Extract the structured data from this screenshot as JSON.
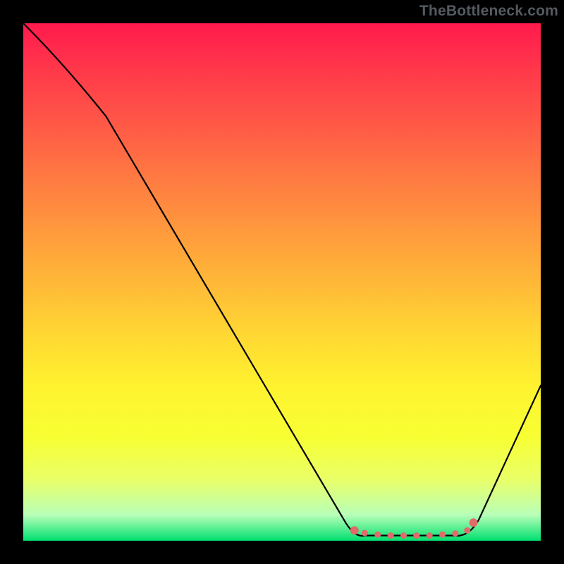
{
  "watermark": "TheBottleneck.com",
  "chart_data": {
    "type": "line",
    "title": "",
    "xlabel": "",
    "ylabel": "",
    "xlim": [
      0,
      1
    ],
    "ylim": [
      0,
      1
    ],
    "series": [
      {
        "name": "curve",
        "x": [
          0.0,
          0.08,
          0.16,
          0.62,
          0.66,
          0.83,
          0.88,
          1.0
        ],
        "y": [
          1.0,
          0.92,
          0.82,
          0.04,
          0.01,
          0.01,
          0.04,
          0.3
        ]
      }
    ],
    "highlight_markers": {
      "x": [
        0.64,
        0.66,
        0.685,
        0.71,
        0.735,
        0.76,
        0.785,
        0.81,
        0.835,
        0.858,
        0.87
      ],
      "y": [
        0.02,
        0.015,
        0.012,
        0.01,
        0.01,
        0.01,
        0.01,
        0.012,
        0.014,
        0.02,
        0.035
      ]
    },
    "marker_color": "#e26a6a",
    "curve_color": "#000000",
    "background_gradient": {
      "stops": [
        {
          "pos": 0.0,
          "color": "#ff1a4d"
        },
        {
          "pos": 0.5,
          "color": "#ffb838"
        },
        {
          "pos": 0.8,
          "color": "#f7ff33"
        },
        {
          "pos": 1.0,
          "color": "#00e070"
        }
      ]
    }
  }
}
